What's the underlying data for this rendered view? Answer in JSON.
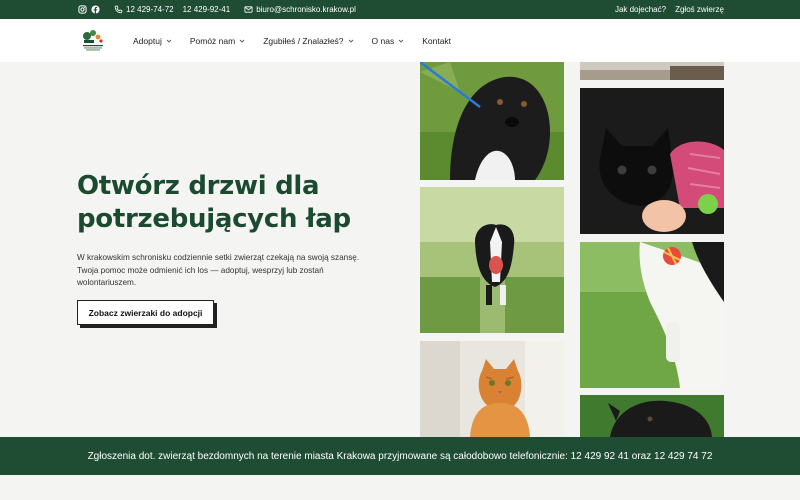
{
  "topbar": {
    "phone_1": "12 429-74-72",
    "phone_2": "12 429-92-41",
    "email": "biuro@schronisko.krakow.pl",
    "link_directions": "Jak dojechać?",
    "link_report": "Zgłoś zwierzę"
  },
  "nav": {
    "items": [
      {
        "label": "Adoptuj"
      },
      {
        "label": "Pomóż nam"
      },
      {
        "label": "Zgubiłeś / Znalazłeś?"
      },
      {
        "label": "O nas"
      },
      {
        "label": "Kontakt"
      }
    ]
  },
  "hero": {
    "title": "Otwórz drzwi dla potrzebujących łap",
    "description": "W krakowskim schronisku codziennie setki zwierząt czekają na swoją szansę. Twoja pomoc może odmienić ich los — adoptuj, wesprzyj lub zostań wolontariuszem.",
    "cta_label": "Zobacz zwierzaki do adopcji"
  },
  "footer": {
    "notice": "Zgłoszenia dot. zwierząt bezdomnych na terenie miasta Krakowa przyjmowane są całodobowo telefonicznie: 12 429 92 41 oraz 12 429 74 72"
  },
  "colors": {
    "brand_green": "#1f4d33",
    "title_green": "#1b4a30",
    "background": "#f4f5f3"
  },
  "icons": [
    "instagram-icon",
    "facebook-icon",
    "phone-icon",
    "mail-icon",
    "chevron-down-icon",
    "logo"
  ]
}
